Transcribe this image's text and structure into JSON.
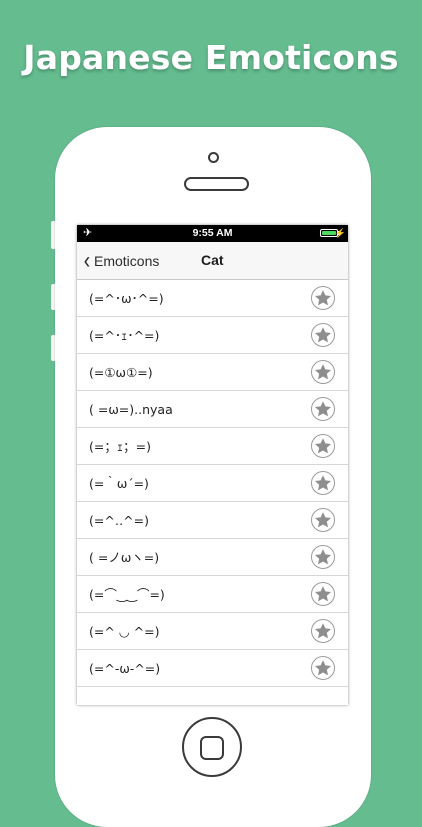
{
  "headline": "Japanese Emoticons",
  "status_bar": {
    "time": "9:55 AM",
    "airplane_icon": "airplane-icon",
    "battery_icon": "battery-icon",
    "charging_icon": "charging-bolt-icon"
  },
  "nav": {
    "back_label": "Emoticons",
    "title": "Cat",
    "back_icon": "chevron-left-icon"
  },
  "emoticons": [
    "(=^･ω･^=)",
    "(=^･ｪ･^=)",
    "(=①ω①=)",
    "( =ω=)..nyaa",
    "(=；ｪ；=)",
    "(=｀ω´=)",
    "(=^‥^=)",
    "( =ノωヽ=)",
    "(=⌒‿‿⌒=)",
    "(=^ ◡ ^=)",
    "(=^-ω-^=)"
  ],
  "favorite_icon": "star-icon",
  "colors": {
    "background": "#64bc8f",
    "star": "#8e8e8e",
    "battery": "#4cd964"
  }
}
